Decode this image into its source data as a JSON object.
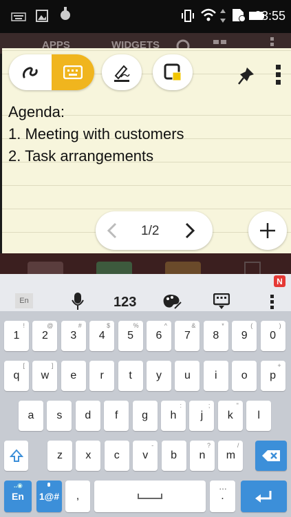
{
  "status_bar": {
    "time": "03:55"
  },
  "launcher": {
    "tab_apps": "APPS",
    "tab_widgets": "WIDGETS"
  },
  "note": {
    "lines": [
      "Agenda:",
      "1. Meeting with customers",
      "2. Task arrangements"
    ],
    "page_indicator": "1/2"
  },
  "keyboard": {
    "top": {
      "lang": "En",
      "numbers": "123",
      "badge": "N"
    },
    "row1": [
      {
        "k": "1",
        "h": "!"
      },
      {
        "k": "2",
        "h": "@"
      },
      {
        "k": "3",
        "h": "#"
      },
      {
        "k": "4",
        "h": "$"
      },
      {
        "k": "5",
        "h": "%"
      },
      {
        "k": "6",
        "h": "^"
      },
      {
        "k": "7",
        "h": "&"
      },
      {
        "k": "8",
        "h": "*"
      },
      {
        "k": "9",
        "h": "("
      },
      {
        "k": "0",
        "h": ")"
      }
    ],
    "row2": [
      {
        "k": "q",
        "h": "["
      },
      {
        "k": "w",
        "h": "]"
      },
      {
        "k": "e",
        "h": ""
      },
      {
        "k": "r",
        "h": ""
      },
      {
        "k": "t",
        "h": ""
      },
      {
        "k": "y",
        "h": ""
      },
      {
        "k": "u",
        "h": ""
      },
      {
        "k": "i",
        "h": ""
      },
      {
        "k": "o",
        "h": ""
      },
      {
        "k": "p",
        "h": "+"
      }
    ],
    "row3": [
      {
        "k": "a",
        "h": ""
      },
      {
        "k": "s",
        "h": ""
      },
      {
        "k": "d",
        "h": ""
      },
      {
        "k": "f",
        "h": ""
      },
      {
        "k": "g",
        "h": ""
      },
      {
        "k": "h",
        "h": ":"
      },
      {
        "k": "j",
        "h": ";"
      },
      {
        "k": "k",
        "h": "\""
      },
      {
        "k": "l",
        "h": ""
      }
    ],
    "row4": [
      {
        "k": "z",
        "h": ""
      },
      {
        "k": "x",
        "h": ""
      },
      {
        "k": "c",
        "h": ""
      },
      {
        "k": "v",
        "h": "-"
      },
      {
        "k": "b",
        "h": ""
      },
      {
        "k": "n",
        "h": "?"
      },
      {
        "k": "m",
        "h": "/"
      }
    ],
    "bottom": {
      "en": "En",
      "sym": "1@#",
      "comma": ",",
      "period": "."
    }
  },
  "colors": {
    "accent": "#f0b51e",
    "blue": "#3c8fd9"
  }
}
